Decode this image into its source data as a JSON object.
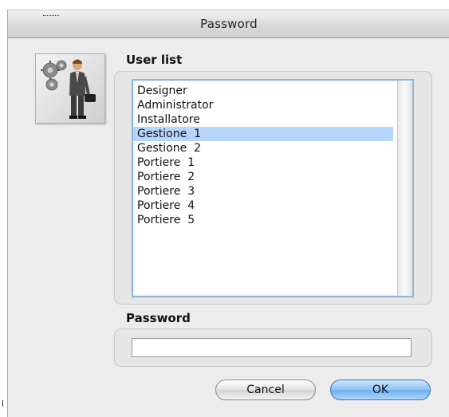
{
  "window": {
    "title": "Password"
  },
  "user_list": {
    "label": "User list",
    "items": [
      "Designer",
      "Administrator",
      "Installatore",
      "Gestione  1",
      "Gestione  2",
      "Portiere  1",
      "Portiere  2",
      "Portiere  3",
      "Portiere  4",
      "Portiere  5"
    ],
    "selected": "Gestione  1"
  },
  "password": {
    "label": "Password",
    "value": ""
  },
  "buttons": {
    "cancel": "Cancel",
    "ok": "OK"
  },
  "icons": {
    "user_icon": "businessman-with-gears-icon"
  },
  "colors": {
    "selection": "#b5d5fe",
    "default_button": "#6fb0ef",
    "focus_ring": "#8fb3da"
  }
}
